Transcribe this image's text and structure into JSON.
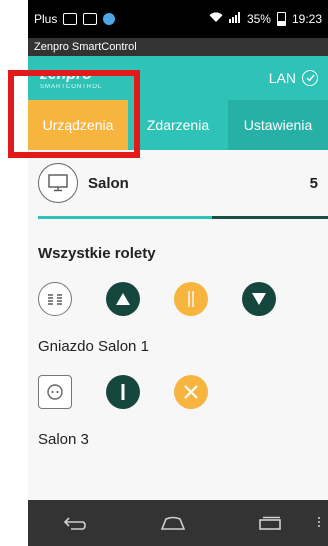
{
  "status_bar": {
    "carrier": "Plus",
    "battery": "35%",
    "time": "19:23"
  },
  "app_title": "Zenpro SmartControl",
  "header": {
    "logo_top": "zenpro",
    "logo_bottom": "SMARTCONTROL",
    "connection": "LAN"
  },
  "tabs": [
    {
      "label": "Urządzenia",
      "active": true
    },
    {
      "label": "Zdarzenia",
      "active": false
    },
    {
      "label": "Ustawienia",
      "active": false
    }
  ],
  "room": {
    "name": "Salon",
    "count": "5",
    "icon": "monitor-icon"
  },
  "sections": [
    {
      "title": "Wszystkie rolety",
      "controls": [
        "blinds-icon",
        "arrow-up-icon",
        "pause-icon",
        "arrow-down-icon"
      ]
    },
    {
      "title": "Gniazdo Salon 1",
      "controls": [
        "socket-icon",
        "power-on-icon",
        "power-off-icon"
      ]
    },
    {
      "title": "Salon 3",
      "controls": []
    }
  ],
  "nav": [
    "back-icon",
    "home-icon",
    "recent-apps-icon",
    "menu-icon"
  ],
  "colors": {
    "teal": "#2fc3b8",
    "orange": "#f7b540",
    "dark_green": "#16473f",
    "highlight": "#e21a1a"
  }
}
